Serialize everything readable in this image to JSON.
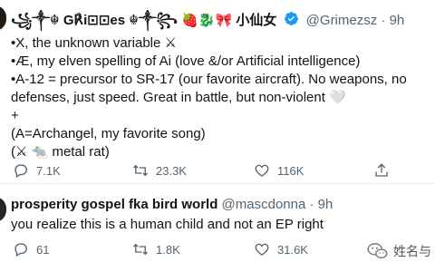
{
  "tweet1": {
    "display_name": "꧁༒☬ G℟i⊡⊡es ☬༒꧂",
    "name_emoji": "🍓🐉🎀",
    "name_suffix": "小仙女",
    "handle": "@Grimezsz",
    "time": "9h",
    "lines": [
      "•X, the unknown variable ⚔",
      "•Æ, my elven spelling of Ai (love &/or Artificial intelligence)",
      "•A-12 = precursor to SR-17 (our favorite aircraft).  No weapons, no",
      "defenses, just speed.  Great in battle, but non-violent 🤍",
      "+",
      "(A=Archangel, my favorite song)",
      "(⚔ 🐀 metal rat)"
    ],
    "actions": {
      "reply_count": "7.1K",
      "retweet_count": "23.3K",
      "like_count": "116K"
    }
  },
  "tweet2": {
    "display_name": "prosperity gospel fka bird world",
    "handle": "@mascdonna",
    "time": "9h",
    "text": "you realize this is a human child and not an EP right",
    "actions": {
      "reply_count": "61",
      "retweet_count": "1.8K",
      "like_count": "31.6K"
    }
  },
  "watermark": {
    "text": "姓名与"
  },
  "colors": {
    "text": "#0f1419",
    "secondary": "#536471",
    "verified": "#1d9bf0",
    "divider": "#e6ecf0"
  }
}
